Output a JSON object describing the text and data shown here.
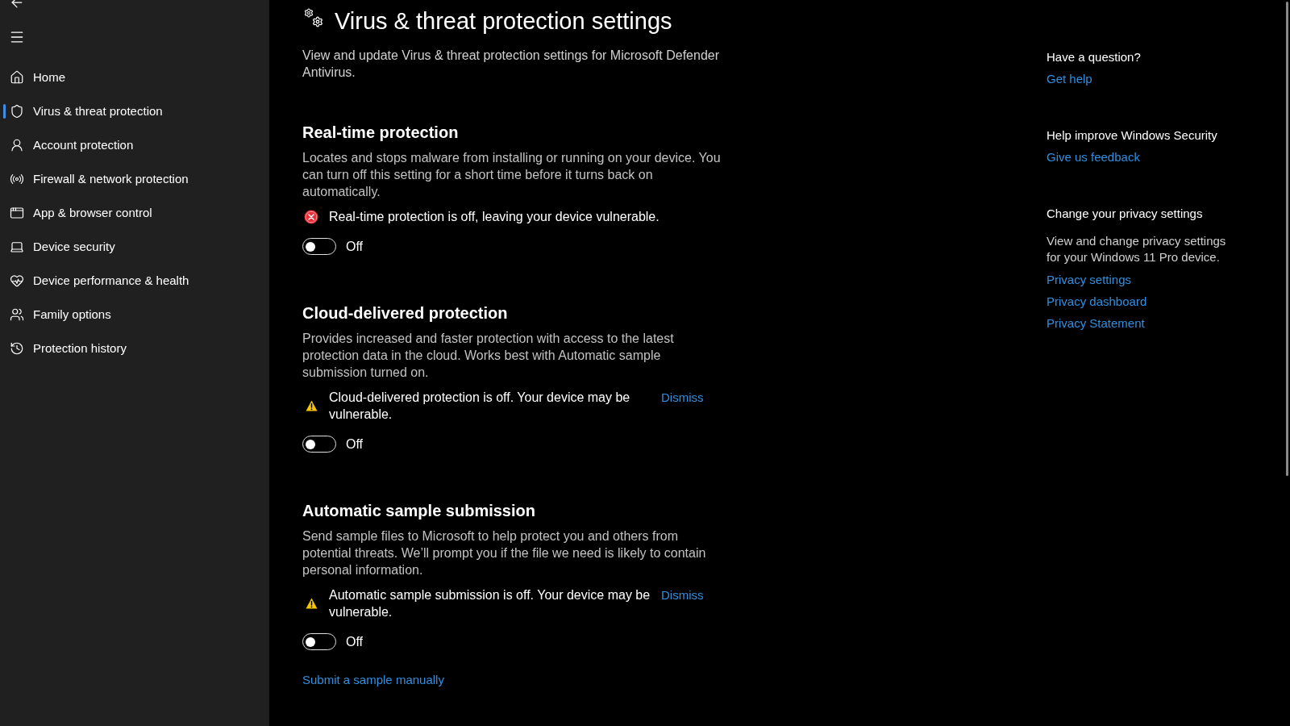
{
  "sidebar": {
    "items": [
      {
        "label": "Home",
        "selected": false
      },
      {
        "label": "Virus & threat protection",
        "selected": true
      },
      {
        "label": "Account protection",
        "selected": false
      },
      {
        "label": "Firewall & network protection",
        "selected": false
      },
      {
        "label": "App & browser control",
        "selected": false
      },
      {
        "label": "Device security",
        "selected": false
      },
      {
        "label": "Device performance & health",
        "selected": false
      },
      {
        "label": "Family options",
        "selected": false
      },
      {
        "label": "Protection history",
        "selected": false
      }
    ]
  },
  "page": {
    "title": "Virus & threat protection settings",
    "description": "View and update Virus & threat protection settings for Microsoft Defender Antivirus.",
    "sections": [
      {
        "heading": "Real-time protection",
        "description": "Locates and stops malware from installing or running on your device. You can turn off this setting for a short time before it turns back on automatically.",
        "status": {
          "kind": "error",
          "message": "Real-time protection is off, leaving your device vulnerable."
        },
        "toggle": {
          "on": false,
          "label": "Off"
        }
      },
      {
        "heading": "Cloud-delivered protection",
        "description": "Provides increased and faster protection with access to the latest protection data in the cloud. Works best with Automatic sample submission turned on.",
        "status": {
          "kind": "warning",
          "message": "Cloud-delivered protection is off. Your device may be vulnerable.",
          "dismiss": "Dismiss"
        },
        "toggle": {
          "on": false,
          "label": "Off"
        }
      },
      {
        "heading": "Automatic sample submission",
        "description": "Send sample files to Microsoft to help protect you and others from potential threats. We’ll prompt you if the file we need is likely to contain personal information.",
        "status": {
          "kind": "warning",
          "message": "Automatic sample submission is off. Your device may be vulnerable.",
          "dismiss": "Dismiss"
        },
        "toggle": {
          "on": false,
          "label": "Off"
        }
      }
    ],
    "footer_link": "Submit a sample manually"
  },
  "help_panel": {
    "groups": [
      {
        "heading": "Have a question?",
        "links": [
          "Get help"
        ]
      },
      {
        "heading": "Help improve Windows Security",
        "links": [
          "Give us feedback"
        ]
      },
      {
        "heading": "Change your privacy settings",
        "description": "View and change privacy settings for your Windows 11 Pro device.",
        "links": [
          "Privacy settings",
          "Privacy dashboard",
          "Privacy Statement"
        ]
      }
    ]
  }
}
